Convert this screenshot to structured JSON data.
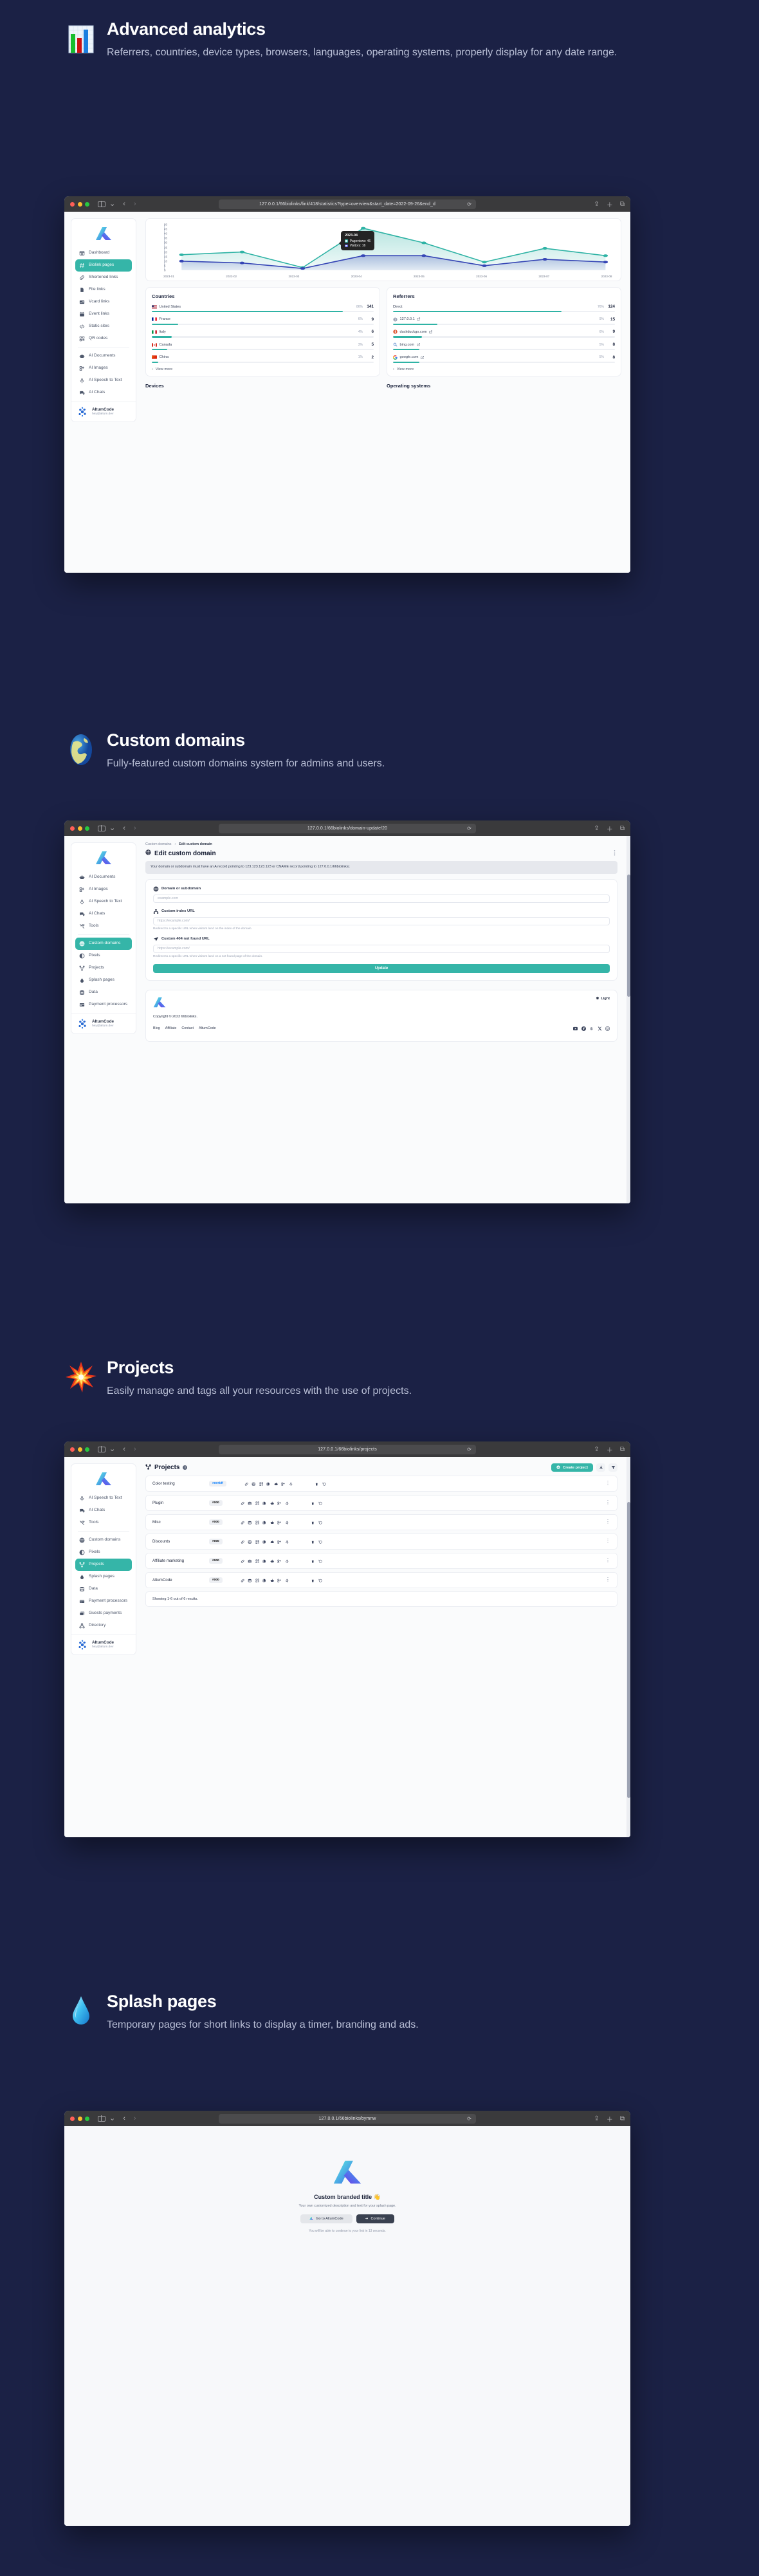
{
  "theme": {
    "bg": "#1b2145",
    "accent": "#35b5a8",
    "chart_pageviews": "#2fb3a5",
    "chart_visitors": "#3545b5"
  },
  "sections": [
    {
      "id": "advanced-analytics",
      "emoji": "bar-chart-icon",
      "title": "Advanced analytics",
      "subtitle": "Referrers, countries, device types, browsers, languages, operating systems, properly display for any date range.",
      "url": "127.0.0.1/66biolinks/link/418/statistics?type=overview&start_date=2022-09-26&end_d"
    },
    {
      "id": "custom-domains",
      "emoji": "globe-icon",
      "title": "Custom domains",
      "subtitle": "Fully-featured custom domains system for admins and users.",
      "url": "127.0.0.1/66biolinks/domain-update/20"
    },
    {
      "id": "projects",
      "emoji": "collision-icon",
      "title": "Projects",
      "subtitle": "Easily manage and tags all your resources with the use of projects.",
      "url": "127.0.0.1/66biolinks/projects"
    },
    {
      "id": "splash-pages",
      "emoji": "droplet-icon",
      "title": "Splash pages",
      "subtitle": "Temporary pages for short links to display a timer, branding and ads.",
      "url": "127.0.0.1/66biolinks/bymnw"
    }
  ],
  "user": {
    "name": "AltumCode",
    "email": "hey@altum.dev"
  },
  "sidebar_analytics": [
    {
      "label": "Dashboard",
      "icon": "grid-icon",
      "active": false
    },
    {
      "label": "Biolink pages",
      "icon": "hash-icon",
      "active": true
    },
    {
      "label": "Shortened links",
      "icon": "link-icon",
      "active": false
    },
    {
      "label": "File links",
      "icon": "file-icon",
      "active": false
    },
    {
      "label": "Vcard links",
      "icon": "vcard-icon",
      "active": false
    },
    {
      "label": "Event links",
      "icon": "calendar-icon",
      "active": false
    },
    {
      "label": "Static sites",
      "icon": "code-icon",
      "active": false
    },
    {
      "label": "QR codes",
      "icon": "qr-icon",
      "active": false
    },
    {
      "label": "AI Documents",
      "icon": "robot-icon",
      "active": false,
      "sep": true
    },
    {
      "label": "AI Images",
      "icon": "ai-image-icon",
      "active": false
    },
    {
      "label": "AI Speech to Text",
      "icon": "mic-icon",
      "active": false
    },
    {
      "label": "AI Chats",
      "icon": "chat-icon",
      "active": false
    }
  ],
  "sidebar_domains": [
    {
      "label": "AI Documents",
      "icon": "robot-icon",
      "active": false
    },
    {
      "label": "AI Images",
      "icon": "ai-image-icon",
      "active": false
    },
    {
      "label": "AI Speech to Text",
      "icon": "mic-icon",
      "active": false
    },
    {
      "label": "AI Chats",
      "icon": "chat-icon",
      "active": false
    },
    {
      "label": "Tools",
      "icon": "tools-icon",
      "active": false
    },
    {
      "label": "Custom domains",
      "icon": "globe-icon",
      "active": true,
      "sep": true
    },
    {
      "label": "Pixels",
      "icon": "pixel-icon",
      "active": false
    },
    {
      "label": "Projects",
      "icon": "project-icon",
      "active": false
    },
    {
      "label": "Splash pages",
      "icon": "droplet-icon",
      "active": false
    },
    {
      "label": "Data",
      "icon": "database-icon",
      "active": false
    },
    {
      "label": "Payment processors",
      "icon": "card-icon",
      "active": false
    }
  ],
  "sidebar_projects": [
    {
      "label": "AI Speech to Text",
      "icon": "mic-icon",
      "active": false
    },
    {
      "label": "AI Chats",
      "icon": "chat-icon",
      "active": false
    },
    {
      "label": "Tools",
      "icon": "tools-icon",
      "active": false
    },
    {
      "label": "Custom domains",
      "icon": "globe-icon",
      "active": false,
      "sep": true
    },
    {
      "label": "Pixels",
      "icon": "pixel-icon",
      "active": false
    },
    {
      "label": "Projects",
      "icon": "project-icon",
      "active": true
    },
    {
      "label": "Splash pages",
      "icon": "droplet-icon",
      "active": false
    },
    {
      "label": "Data",
      "icon": "database-icon",
      "active": false
    },
    {
      "label": "Payment processors",
      "icon": "card-icon",
      "active": false
    },
    {
      "label": "Guests payments",
      "icon": "guest-pay-icon",
      "active": false
    },
    {
      "label": "Directory",
      "icon": "directory-icon",
      "active": false
    }
  ],
  "chart_data": {
    "type": "line",
    "title": "",
    "x": [
      "2023-01",
      "2023-02",
      "2023-03",
      "2023-04",
      "2023-05",
      "2023-06",
      "2023-07",
      "2023-08"
    ],
    "series": [
      {
        "name": "Pageviews",
        "color": "#2fb3a5",
        "values": [
          17,
          20,
          3,
          46,
          30,
          9,
          24,
          16
        ]
      },
      {
        "name": "Visitors",
        "color": "#3545b5",
        "values": [
          10,
          8,
          2,
          16,
          16,
          5,
          12,
          9
        ]
      }
    ],
    "ylim": [
      0,
      50
    ],
    "yticks": [
      0,
      5,
      10,
      15,
      20,
      25,
      30,
      35,
      40,
      45,
      50
    ],
    "grid": false,
    "legend": "none",
    "tooltip": {
      "title": "2023-04",
      "rows": [
        {
          "label": "Pageviews: 46",
          "color": "#2fb3a5"
        },
        {
          "label": "Visitors: 16",
          "color": "#4b54dd"
        }
      ]
    }
  },
  "stats": {
    "countries": {
      "title": "Countries",
      "rows": [
        {
          "name": "United States",
          "flag": "us",
          "pct": "86%",
          "value": "141",
          "bar": 86
        },
        {
          "name": "France",
          "flag": "fr",
          "pct": "6%",
          "value": "9",
          "bar": 12
        },
        {
          "name": "Italy",
          "flag": "it",
          "pct": "4%",
          "value": "6",
          "bar": 9
        },
        {
          "name": "Canada",
          "flag": "ca",
          "pct": "3%",
          "value": "5",
          "bar": 7
        },
        {
          "name": "China",
          "flag": "cn",
          "pct": "1%",
          "value": "2",
          "bar": 3
        }
      ],
      "view_more": "View more"
    },
    "referrers": {
      "title": "Referrers",
      "rows": [
        {
          "name": "Direct",
          "icon": "none",
          "pct": "76%",
          "value": "124",
          "bar": 76,
          "ext": false
        },
        {
          "name": "127.0.0.1",
          "icon": "arrow-circle-icon",
          "pct": "9%",
          "value": "15",
          "bar": 20,
          "ext": true
        },
        {
          "name": "duckduckgo.com",
          "icon": "duckduckgo-icon",
          "pct": "6%",
          "value": "9",
          "bar": 13,
          "ext": true
        },
        {
          "name": "bing.com",
          "icon": "bing-icon",
          "pct": "5%",
          "value": "8",
          "bar": 12,
          "ext": true
        },
        {
          "name": "google.com",
          "icon": "google-icon",
          "pct": "5%",
          "value": "8",
          "bar": 12,
          "ext": true
        }
      ],
      "view_more": "View more"
    },
    "devices_label": "Devices",
    "os_label": "Operating systems"
  },
  "domain_page": {
    "breadcrumb_parent": "Custom domains",
    "breadcrumb_current": "Edit custom domain",
    "heading": "Edit custom domain",
    "notice": "Your domain or subdomain must have an A record pointing to 123.123.123.123 or CNAME record pointing to 127.0.0.1/66biolinks/.",
    "fields": [
      {
        "label": "Domain or subdomain",
        "icon": "globe-icon",
        "placeholder": "example.com",
        "help": ""
      },
      {
        "label": "Custom index URL",
        "icon": "sitemap-icon",
        "placeholder": "https://example.com/",
        "help": "Redirect to a specific URL when visitors land on the index of the domain."
      },
      {
        "label": "Custom 404 not found URL",
        "icon": "send-icon",
        "placeholder": "https://example.com/",
        "help": "Redirect to a specific URL when visitors land on a not found page of the domain."
      }
    ],
    "submit": "Update",
    "footer": {
      "light_label": "Light",
      "copyright": "Copyright © 2023 66biolinks.",
      "links": [
        "Blog",
        "Affiliate",
        "Contact",
        "AltumCode"
      ],
      "socials": [
        "youtube-icon",
        "facebook-icon",
        "threads-icon",
        "x-icon",
        "instagram-icon"
      ]
    }
  },
  "projects_page": {
    "heading": "Projects",
    "create_label": "Create project",
    "export_icon": "download-icon",
    "filter_icon": "filter-icon",
    "row_icons": [
      "link-icon",
      "database-icon",
      "qr-icon",
      "file-stack-icon",
      "robot-icon",
      "ai-image-icon",
      "mic-icon"
    ],
    "row_actions": [
      "trash-icon",
      "restore-icon"
    ],
    "rows": [
      {
        "name": "Color testing",
        "color": "#007bff"
      },
      {
        "name": "Plugin",
        "color": "#000"
      },
      {
        "name": "Misc",
        "color": "#000"
      },
      {
        "name": "Discounts",
        "color": "#000"
      },
      {
        "name": "Affiliate marketing",
        "color": "#000"
      },
      {
        "name": "AltumCode",
        "color": "#000"
      }
    ],
    "showing": "Showing 1-6 out of 6 results."
  },
  "splash_page": {
    "title": "Custom branded title 👋",
    "subtitle": "Your own customized description and text for your splash page.",
    "btn_left": "Go to AltumCode",
    "btn_right": "Continue",
    "timer": "You will be able to continue to your link in 13 seconds."
  }
}
